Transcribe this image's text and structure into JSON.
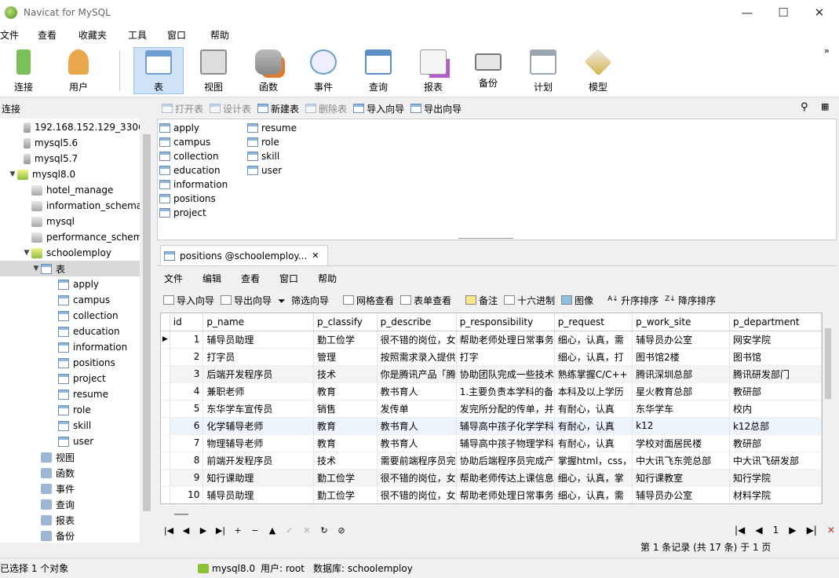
{
  "window": {
    "title": "Navicat for MySQL",
    "minimize": "—",
    "maximize": "☐",
    "close": "✕"
  },
  "menu": [
    "文件",
    "查看",
    "收藏夹",
    "工具",
    "窗口",
    "帮助"
  ],
  "toolbar": [
    {
      "label": "连接",
      "icon": "connection-icon",
      "color": "#7cc05a"
    },
    {
      "label": "用户",
      "icon": "user-icon",
      "color": "#e9a64a"
    },
    {
      "label": "表",
      "icon": "table-icon",
      "color": "#6f9ed0"
    },
    {
      "label": "视图",
      "icon": "view-icon",
      "color": "#8c8c8c"
    },
    {
      "label": "函数",
      "icon": "function-icon",
      "color": "#e07b2e"
    },
    {
      "label": "事件",
      "icon": "event-icon",
      "color": "#6aa0c8"
    },
    {
      "label": "查询",
      "icon": "query-icon",
      "color": "#5b8fc6"
    },
    {
      "label": "报表",
      "icon": "report-icon",
      "color": "#b45ac9"
    },
    {
      "label": "备份",
      "icon": "backup-icon",
      "color": "#777777"
    },
    {
      "label": "计划",
      "icon": "schedule-icon",
      "color": "#9aa6b2"
    },
    {
      "label": "模型",
      "icon": "model-icon",
      "color": "#d6b24a"
    }
  ],
  "left_header": "连接",
  "tree": [
    {
      "label": "192.168.152.129_3306",
      "indent": 0,
      "icon": "conn",
      "arrow": ""
    },
    {
      "label": "mysql5.6",
      "indent": 0,
      "icon": "conn",
      "arrow": ""
    },
    {
      "label": "mysql5.7",
      "indent": 0,
      "icon": "conn",
      "arrow": ""
    },
    {
      "label": "mysql8.0",
      "indent": 0,
      "icon": "db-open",
      "arrow": "▼"
    },
    {
      "label": "hotel_manage",
      "indent": 1,
      "icon": "db",
      "arrow": ""
    },
    {
      "label": "information_schema",
      "indent": 1,
      "icon": "db",
      "arrow": ""
    },
    {
      "label": "mysql",
      "indent": 1,
      "icon": "db",
      "arrow": ""
    },
    {
      "label": "performance_schema",
      "indent": 1,
      "icon": "db",
      "arrow": ""
    },
    {
      "label": "schoolemploy",
      "indent": 1,
      "icon": "db-open",
      "arrow": "▼"
    },
    {
      "label": "表",
      "indent": 2,
      "icon": "table",
      "arrow": "▼",
      "selected": true
    },
    {
      "label": "apply",
      "indent": 3,
      "icon": "table",
      "arrow": ""
    },
    {
      "label": "campus",
      "indent": 3,
      "icon": "table",
      "arrow": ""
    },
    {
      "label": "collection",
      "indent": 3,
      "icon": "table",
      "arrow": ""
    },
    {
      "label": "education",
      "indent": 3,
      "icon": "table",
      "arrow": ""
    },
    {
      "label": "information",
      "indent": 3,
      "icon": "table",
      "arrow": ""
    },
    {
      "label": "positions",
      "indent": 3,
      "icon": "table",
      "arrow": ""
    },
    {
      "label": "project",
      "indent": 3,
      "icon": "table",
      "arrow": ""
    },
    {
      "label": "resume",
      "indent": 3,
      "icon": "table",
      "arrow": ""
    },
    {
      "label": "role",
      "indent": 3,
      "icon": "table",
      "arrow": ""
    },
    {
      "label": "skill",
      "indent": 3,
      "icon": "table",
      "arrow": ""
    },
    {
      "label": "user",
      "indent": 3,
      "icon": "table",
      "arrow": ""
    },
    {
      "label": "视图",
      "indent": 2,
      "icon": "generic",
      "arrow": ""
    },
    {
      "label": "函数",
      "indent": 2,
      "icon": "generic",
      "arrow": ""
    },
    {
      "label": "事件",
      "indent": 2,
      "icon": "generic",
      "arrow": ""
    },
    {
      "label": "查询",
      "indent": 2,
      "icon": "generic",
      "arrow": ""
    },
    {
      "label": "报表",
      "indent": 2,
      "icon": "generic",
      "arrow": ""
    },
    {
      "label": "备份",
      "indent": 2,
      "icon": "generic",
      "arrow": ""
    }
  ],
  "obj_toolbar": [
    {
      "label": "打开表",
      "disabled": true
    },
    {
      "label": "设计表",
      "disabled": true
    },
    {
      "label": "新建表",
      "disabled": false
    },
    {
      "label": "删除表",
      "disabled": true
    },
    {
      "label": "导入向导",
      "disabled": false
    },
    {
      "label": "导出向导",
      "disabled": false
    }
  ],
  "objects_col1": [
    "apply",
    "campus",
    "collection",
    "education",
    "information",
    "positions",
    "project"
  ],
  "objects_col2": [
    "resume",
    "role",
    "skill",
    "user"
  ],
  "tab": {
    "title": "positions @schoolemploy...",
    "close": "✕"
  },
  "editor_menu": [
    "文件",
    "编辑",
    "查看",
    "窗口",
    "帮助"
  ],
  "grid_toolbar": [
    "导入向导",
    "导出向导",
    "筛选向导",
    "网格查看",
    "表单查看",
    "备注",
    "十六进制",
    "图像",
    "升序排序",
    "降序排序"
  ],
  "grid": {
    "columns": [
      "id",
      "p_name",
      "p_classify",
      "p_describe",
      "p_responsibility",
      "p_request",
      "p_work_site",
      "p_department"
    ],
    "rows": [
      [
        "1",
        "辅导员助理",
        "勤工俭学",
        "很不错的岗位，女",
        "帮助老师处理日常事务",
        "细心，认真，需",
        "辅导员办公室",
        "网安学院"
      ],
      [
        "2",
        "打字员",
        "管理",
        "按照需求录入提供",
        "打字",
        "细心，认真，打",
        "图书馆2楼",
        "图书馆"
      ],
      [
        "3",
        "后端开发程序员",
        "技术",
        "你是腾讯产品「腾",
        "协助团队完成一些技术",
        "熟练掌握C/C++",
        "腾讯深圳总部",
        "腾讯研发部门"
      ],
      [
        "4",
        "兼职老师",
        "教育",
        "教书育人",
        "1.主要负责本学科的备",
        "本科及以上学历",
        "星火教育总部",
        "教研部"
      ],
      [
        "5",
        "东华学车宣传员",
        "销售",
        "发传单",
        "发完所分配的传单，并",
        "有耐心，认真",
        "东华学车",
        "校内"
      ],
      [
        "6",
        "化学辅导老师",
        "教育",
        "教书育人",
        "辅导高中孩子化学学科",
        "有耐心，认真",
        "k12",
        "k12总部"
      ],
      [
        "7",
        "物理辅导老师",
        "教育",
        "教书育人",
        "辅导高中孩子物理学科",
        "有耐心，认真",
        "学校对面居民楼",
        "教研部"
      ],
      [
        "8",
        "前端开发程序员",
        "技术",
        "需要前端程序员完",
        "协助后端程序员完成产",
        "掌握html，css，",
        "中大讯飞东莞总部",
        "中大讯飞研发部"
      ],
      [
        "9",
        "知行课助理",
        "勤工俭学",
        "很不错的岗位，女",
        "帮助老师传达上课信息",
        "细心，认真，掌",
        "知行课教室",
        "知行学院"
      ],
      [
        "10",
        "辅导员助理",
        "勤工俭学",
        "很不错的岗位，女",
        "帮助老师处理日常事务",
        "细心，认真，需",
        "辅导员办公室",
        "材料学院"
      ]
    ]
  },
  "nav_buttons": [
    "|◀",
    "◀",
    "▶",
    "▶|",
    "+",
    "−",
    "▲",
    "✓",
    "✕",
    "↻",
    "⊘"
  ],
  "page": {
    "first": "|◀",
    "prev": "◀",
    "current": "1",
    "next": "▶",
    "last": "▶|",
    "settings": "✕"
  },
  "records_text": "第 1 条记录 (共 17 条) 于 1 页",
  "status": {
    "selected": "已选择 1 个对象",
    "connection": "mysql8.0",
    "user": "用户: root",
    "database": "数据库: schoolemploy"
  }
}
